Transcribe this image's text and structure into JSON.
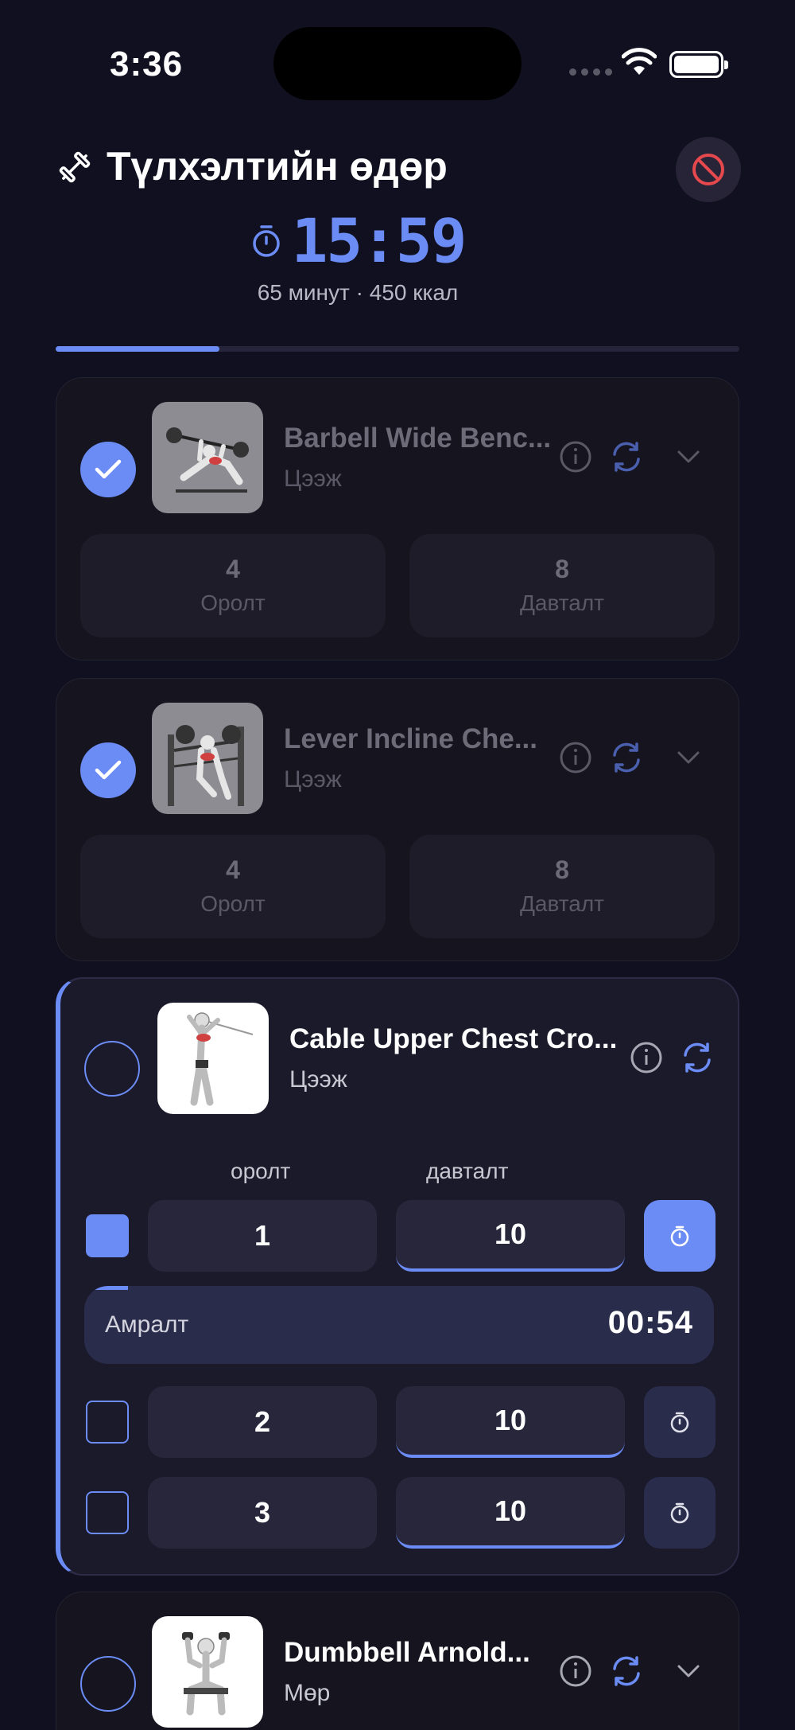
{
  "status_bar": {
    "time": "3:36"
  },
  "header": {
    "title": "Түлхэлтийн өдөр",
    "timer": "15:59",
    "subtitle": "65 минут · 450 ккал",
    "progress": 0.24
  },
  "exercises": [
    {
      "name": "Barbell Wide Benc...",
      "group": "Цээж",
      "done": true,
      "sets_value": "4",
      "sets_label": "Оролт",
      "reps_value": "8",
      "reps_label": "Давталт"
    },
    {
      "name": "Lever Incline Che...",
      "group": "Цээж",
      "done": true,
      "sets_value": "4",
      "sets_label": "Оролт",
      "reps_value": "8",
      "reps_label": "Давталт"
    }
  ],
  "active": {
    "name": "Cable Upper Chest Cro...",
    "group": "Цээж",
    "col_sets": "оролт",
    "col_reps": "давталт",
    "sets": [
      {
        "set": "1",
        "reps": "10",
        "done": true
      },
      {
        "set": "2",
        "reps": "10",
        "done": false
      },
      {
        "set": "3",
        "reps": "10",
        "done": false
      }
    ],
    "rest_label": "Амралт",
    "rest_time": "00:54",
    "rest_progress": 0.07
  },
  "next_exercise": {
    "name": "Dumbbell Arnold...",
    "group": "Мөр",
    "done": false
  },
  "colors": {
    "accent": "#6c8cf5",
    "background": "#111020",
    "danger": "#e5484d"
  }
}
